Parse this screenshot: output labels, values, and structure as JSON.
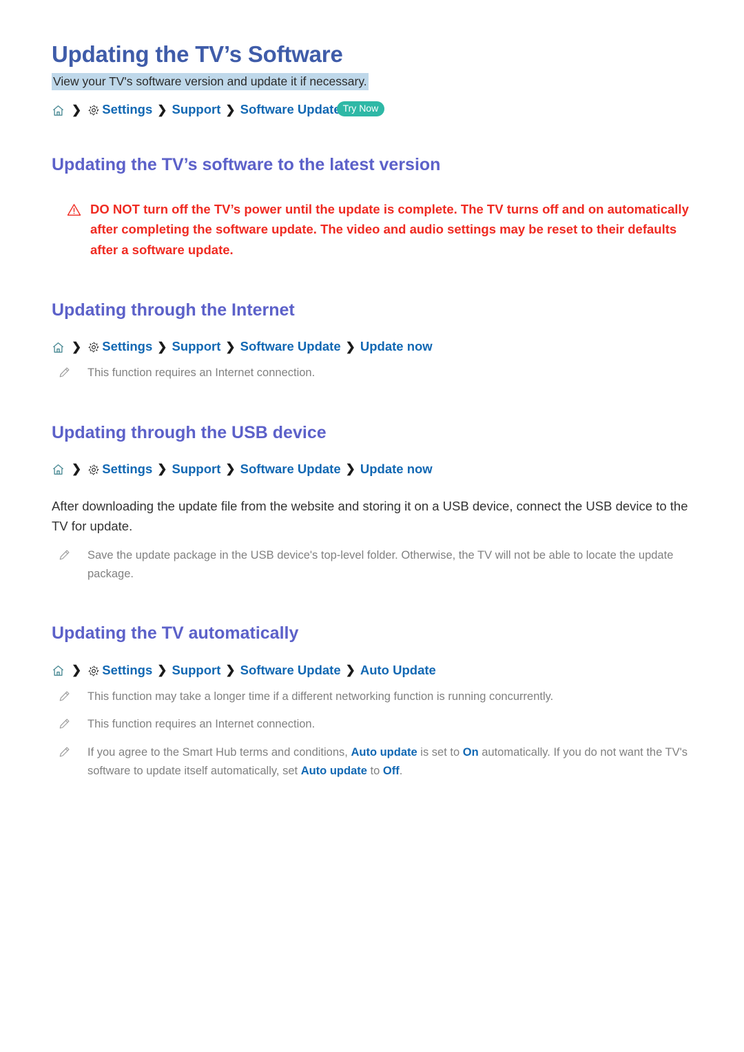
{
  "page": {
    "title": "Updating the TV’s Software",
    "subtitle": "View your TV's software version and update it if necessary."
  },
  "colors": {
    "title_blue": "#3f5ca9",
    "heading_purple": "#5c61c9",
    "link_blue": "#1268b3",
    "warning_red": "#ef2b22",
    "badge_teal": "#2eb8a6",
    "highlight_blue": "#bfd8ea",
    "note_gray": "#818181",
    "body_gray": "#333333"
  },
  "breadcrumbs": {
    "top": {
      "home_icon": "home-icon",
      "gear_icon": "gear-icon",
      "separator": "❯",
      "items": [
        "Settings",
        "Support",
        "Software Update"
      ],
      "badge": "Try Now"
    },
    "internet": {
      "home_icon": "home-icon",
      "gear_icon": "gear-icon",
      "items": [
        "Settings",
        "Support",
        "Software Update",
        "Update now"
      ]
    },
    "usb": {
      "home_icon": "home-icon",
      "gear_icon": "gear-icon",
      "items": [
        "Settings",
        "Support",
        "Software Update",
        "Update now"
      ]
    },
    "auto": {
      "home_icon": "home-icon",
      "gear_icon": "gear-icon",
      "items": [
        "Settings",
        "Support",
        "Software Update",
        "Auto Update"
      ]
    }
  },
  "sections": {
    "latest_version": {
      "heading": "Updating the TV’s software to the latest version",
      "warning_icon": "warning-triangle-icon",
      "warning": "DO NOT turn off the TV’s power until the update is complete. The TV turns off and on automatically after completing the software update. The video and audio settings may be reset to their defaults after a software update."
    },
    "internet": {
      "heading": "Updating through the Internet",
      "notes": [
        {
          "icon": "pencil-note-icon",
          "text": "This function requires an Internet connection."
        }
      ]
    },
    "usb": {
      "heading": "Updating through the USB device",
      "paragraph": "After downloading the update file from the website and storing it on a USB device, connect the USB device to the TV for update.",
      "notes": [
        {
          "icon": "pencil-note-icon",
          "text": "Save the update package in the USB device's top-level folder. Otherwise, the TV will not be able to locate the update package."
        }
      ]
    },
    "auto": {
      "heading": "Updating the TV automatically",
      "notes": [
        {
          "icon": "pencil-note-icon",
          "text": "This function may take a longer time if a different networking function is running concurrently."
        },
        {
          "icon": "pencil-note-icon",
          "text": "This function requires an Internet connection."
        },
        {
          "icon": "pencil-note-icon",
          "parts": {
            "p1": "If you agree to the Smart Hub terms and conditions, ",
            "b1": "Auto update",
            "p2": " is set to ",
            "b2": "On",
            "p3": " automatically. If you do not want the TV's software to update itself automatically, set ",
            "b3": "Auto update",
            "p4": " to ",
            "b4": "Off",
            "p5": "."
          }
        }
      ]
    }
  }
}
